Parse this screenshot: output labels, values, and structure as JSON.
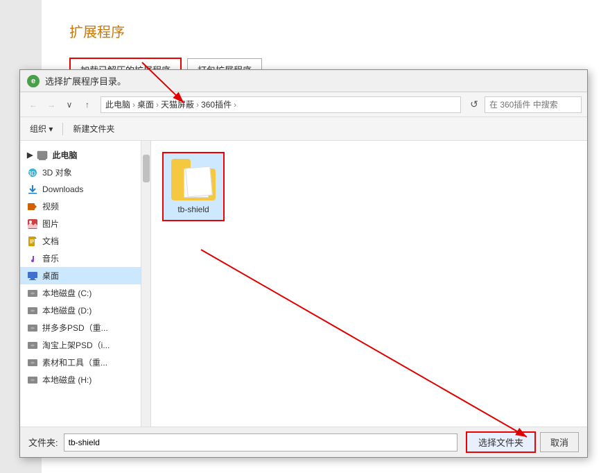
{
  "page": {
    "bg_color": "#e0e0e0"
  },
  "ext_page": {
    "title": "扩展程序",
    "btn_load_label": "加载已解压的扩展程序",
    "btn_pack_label": "打包扩展程序"
  },
  "dialog": {
    "title": "选择扩展程序目录。",
    "title_icon": "e",
    "nav": {
      "back_label": "←",
      "forward_label": "→",
      "up_label": "↑",
      "breadcrumb": [
        "此电脑",
        "桌面",
        "天猫屏蔽",
        "360插件"
      ],
      "search_placeholder": "在 360插件 中搜索"
    },
    "toolbar": {
      "organize_label": "组织 ▾",
      "new_folder_label": "新建文件夹"
    },
    "sidebar": {
      "items": [
        {
          "id": "pc",
          "label": "此电脑",
          "icon": "pc",
          "level": 0
        },
        {
          "id": "3d",
          "label": "3D 对象",
          "icon": "3d",
          "level": 1
        },
        {
          "id": "downloads",
          "label": "Downloads",
          "icon": "dl",
          "level": 1
        },
        {
          "id": "video",
          "label": "视频",
          "icon": "video",
          "level": 1
        },
        {
          "id": "pic",
          "label": "图片",
          "icon": "pic",
          "level": 1
        },
        {
          "id": "doc",
          "label": "文档",
          "icon": "doc",
          "level": 1
        },
        {
          "id": "music",
          "label": "音乐",
          "icon": "music",
          "level": 1
        },
        {
          "id": "desktop",
          "label": "桌面",
          "icon": "desktop",
          "level": 1,
          "active": true
        },
        {
          "id": "disk-c",
          "label": "本地磁盘 (C:)",
          "icon": "disk",
          "level": 1
        },
        {
          "id": "disk-d",
          "label": "本地磁盘 (D:)",
          "icon": "disk",
          "level": 1
        },
        {
          "id": "disk-psd",
          "label": "拼多多PSD（重...",
          "icon": "disk",
          "level": 1
        },
        {
          "id": "disk-taobao",
          "label": "淘宝上架PSD（i...",
          "icon": "disk",
          "level": 1
        },
        {
          "id": "disk-material",
          "label": "素材和工具（重...",
          "icon": "disk",
          "level": 1
        },
        {
          "id": "disk-h",
          "label": "本地磁盘 (H:)",
          "icon": "disk",
          "level": 1
        }
      ]
    },
    "files": [
      {
        "name": "tb-shield",
        "type": "folder",
        "selected": true
      }
    ],
    "bottom": {
      "label": "文件夹:",
      "value": "tb-shield",
      "btn_select": "选择文件夹",
      "btn_cancel": "取消"
    }
  },
  "arrows": {
    "color": "#e00000"
  }
}
